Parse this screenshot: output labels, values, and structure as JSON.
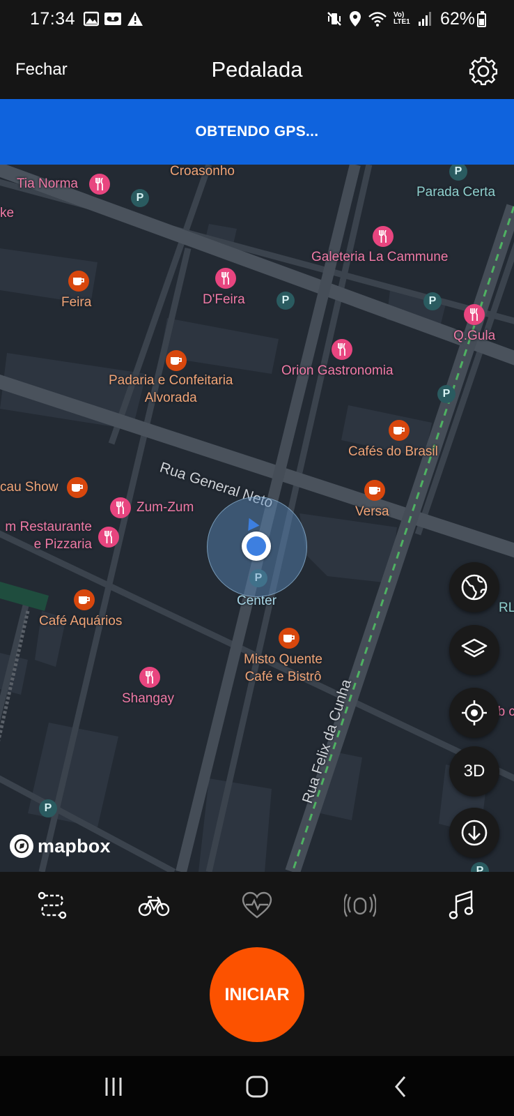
{
  "status_bar": {
    "time": "17:34",
    "battery": "62%",
    "left_icons": [
      "image-icon",
      "voicemail-icon",
      "warning-icon"
    ],
    "right_icons": [
      "mute-vibrate-icon",
      "location-icon",
      "wifi-icon",
      "volte-lte-icon",
      "signal-icon",
      "battery-icon"
    ],
    "network_label": "Vo) LTE1"
  },
  "header": {
    "close_label": "Fechar",
    "title": "Pedalada",
    "settings_icon": "gear-icon"
  },
  "gps_banner": {
    "text": "OBTENDO GPS..."
  },
  "map": {
    "streets": {
      "general_neto": "Rua General Neto",
      "felix_da_cunha": "Rua Felix da Cunha"
    },
    "pois": {
      "croasonho": "Croasonho",
      "tia_norma": "Tia Norma",
      "ke": "ke",
      "parada_certa": "Parada Certa",
      "galeteria": "Galeteria La Cammune",
      "feira": "Feira",
      "dfeira": "D'Feira",
      "qgula": "Q.Gula",
      "orion": "Orion Gastronomia",
      "padaria_line1": "Padaria e Confeitaria",
      "padaria_line2": "Alvorada",
      "cafes_brasil": "Cafés do Brasil",
      "cau_show": "cau Show",
      "zumzum": "Zum-Zum",
      "versa": "Versa",
      "restaurante_line1": "m Restaurante",
      "restaurante_line2": "e Pizzaria",
      "center": "Center",
      "rl": "RL",
      "cafe_aquarios": "Café Aquários",
      "misto_line1": "Misto Quente",
      "misto_line2": "Café e Bistrô",
      "shangay": "Shangay",
      "ub": "ub c"
    },
    "parking_letter": "P",
    "controls": {
      "globe_icon": "globe-icon",
      "layers_icon": "layers-icon",
      "locate_icon": "crosshair-icon",
      "mode_3d_label": "3D",
      "download_icon": "download-icon"
    },
    "attribution": "mapbox"
  },
  "bottom_tabs": [
    {
      "name": "route-icon"
    },
    {
      "name": "bike-icon"
    },
    {
      "name": "heart-rate-icon"
    },
    {
      "name": "sensor-icon"
    },
    {
      "name": "music-icon"
    }
  ],
  "start_button": {
    "label": "INICIAR"
  },
  "colors": {
    "banner": "#0f63dd",
    "start": "#fc5200",
    "map_bg": "#232a33",
    "food_poi": "#f07aa6",
    "cafe_poi": "#f0a477",
    "park_poi": "#8fd0ce"
  },
  "nav_bar": {
    "icons": [
      "recent-apps-icon",
      "home-icon",
      "back-icon"
    ]
  }
}
